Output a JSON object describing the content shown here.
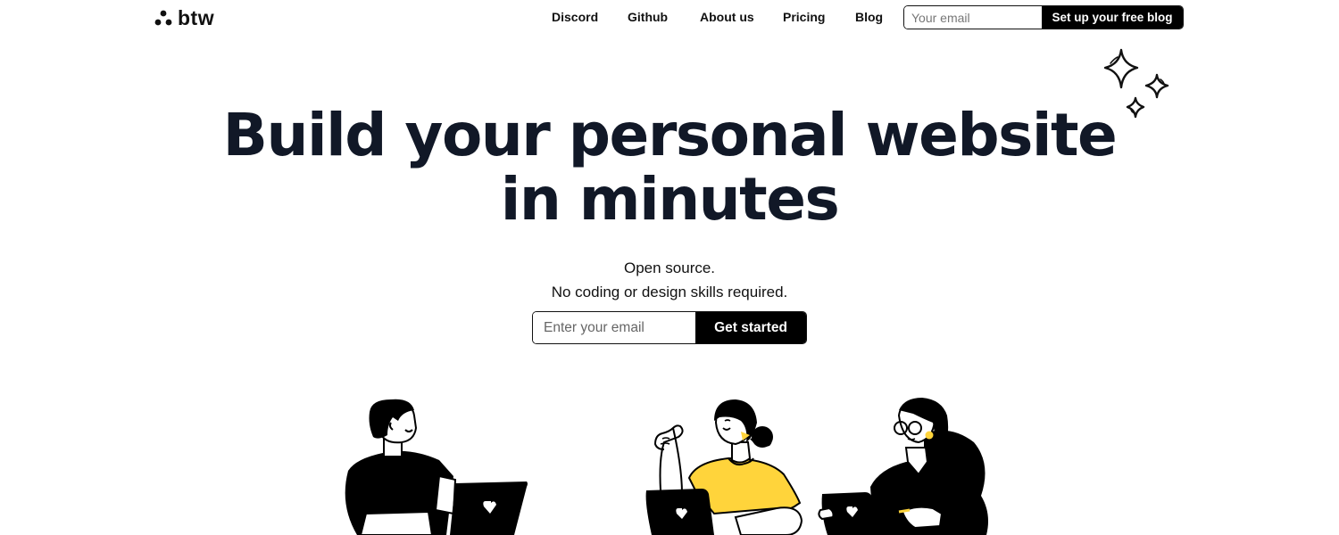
{
  "header": {
    "logo_text": "btw",
    "nav": [
      {
        "label": "Discord"
      },
      {
        "label": "Github"
      },
      {
        "label": "About us"
      },
      {
        "label": "Pricing"
      },
      {
        "label": "Blog"
      }
    ],
    "email_placeholder": "Your email",
    "cta_label": "Set up your free blog"
  },
  "hero": {
    "headline_line1": "Build your personal website",
    "headline_line2": "in minutes",
    "subtitle_line1": "Open source.",
    "subtitle_line2": "No coding or design skills required.",
    "email_placeholder": "Enter your email",
    "cta_label": "Get started"
  },
  "colors": {
    "text": "#111827",
    "accent_yellow": "#FFD43B",
    "button_bg": "#000000"
  },
  "illustrations": [
    {
      "icon": "person-with-laptop-icon"
    },
    {
      "icon": "woman-raising-hand-icon"
    },
    {
      "icon": "woman-with-glasses-tablet-icon"
    }
  ]
}
